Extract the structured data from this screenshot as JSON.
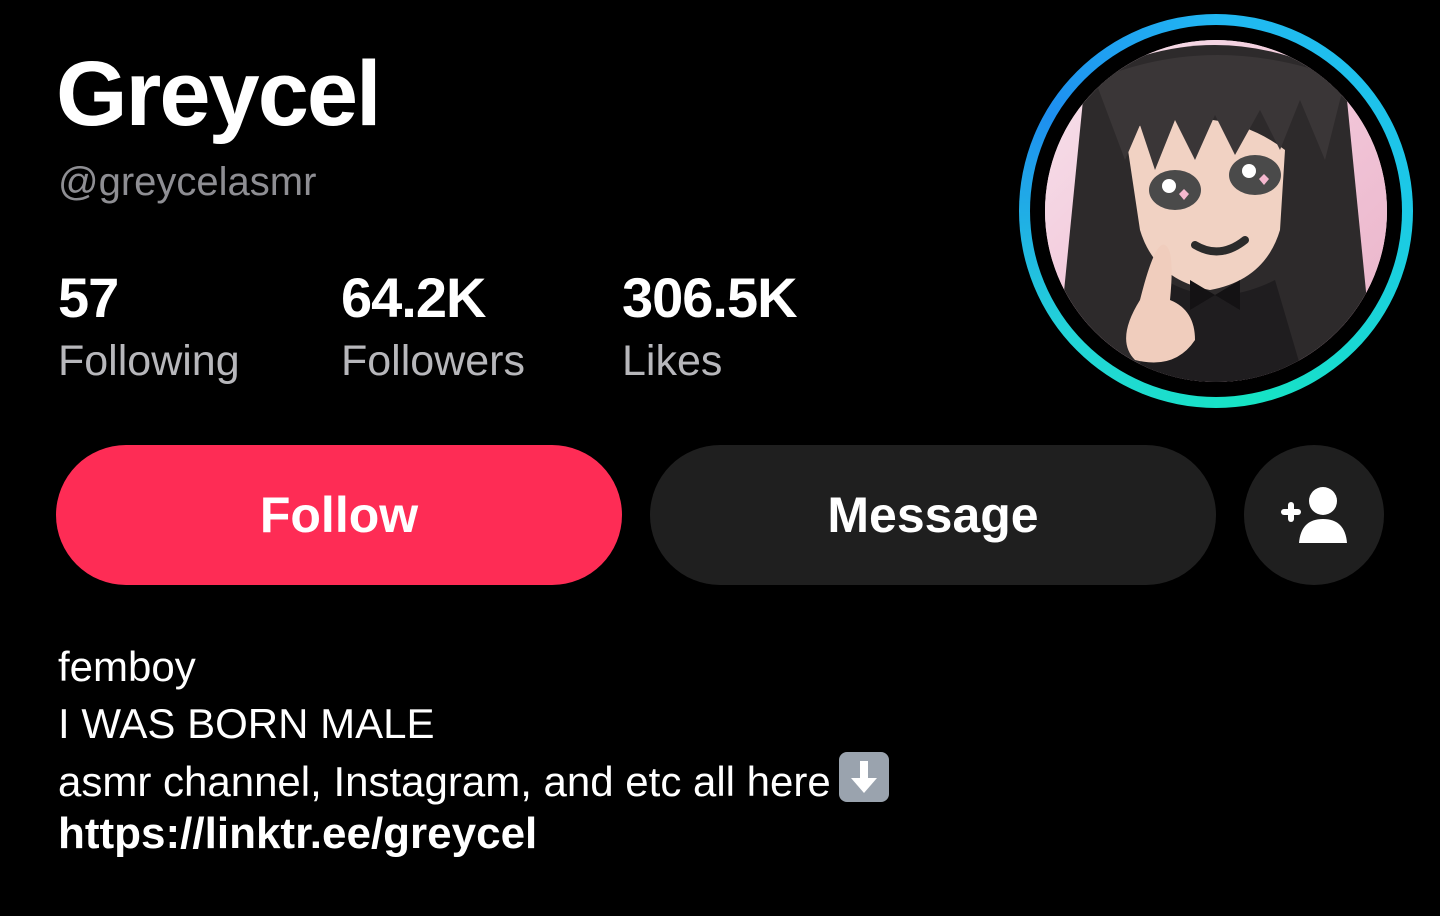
{
  "profile": {
    "display_name": "Greycel",
    "handle": "@greycelasmr"
  },
  "stats": [
    {
      "value": "57",
      "label": "Following"
    },
    {
      "value": "64.2K",
      "label": "Followers"
    },
    {
      "value": "306.5K",
      "label": "Likes"
    }
  ],
  "actions": {
    "follow_label": "Follow",
    "message_label": "Message",
    "add_friend_icon": "person-add-icon"
  },
  "bio": {
    "lines": [
      "femboy",
      "I WAS BORN MALE",
      "asmr channel, Instagram, and etc all here"
    ],
    "arrow_icon": "down-arrow-emoji-icon",
    "link": "https://linktr.ee/greycel"
  },
  "colors": {
    "background": "#000000",
    "follow": "#fe2c55",
    "secondary_button": "#1f1f1f",
    "muted_text": "#8e8e93",
    "ring_start": "#21b7f2",
    "ring_end": "#16e4c4"
  }
}
